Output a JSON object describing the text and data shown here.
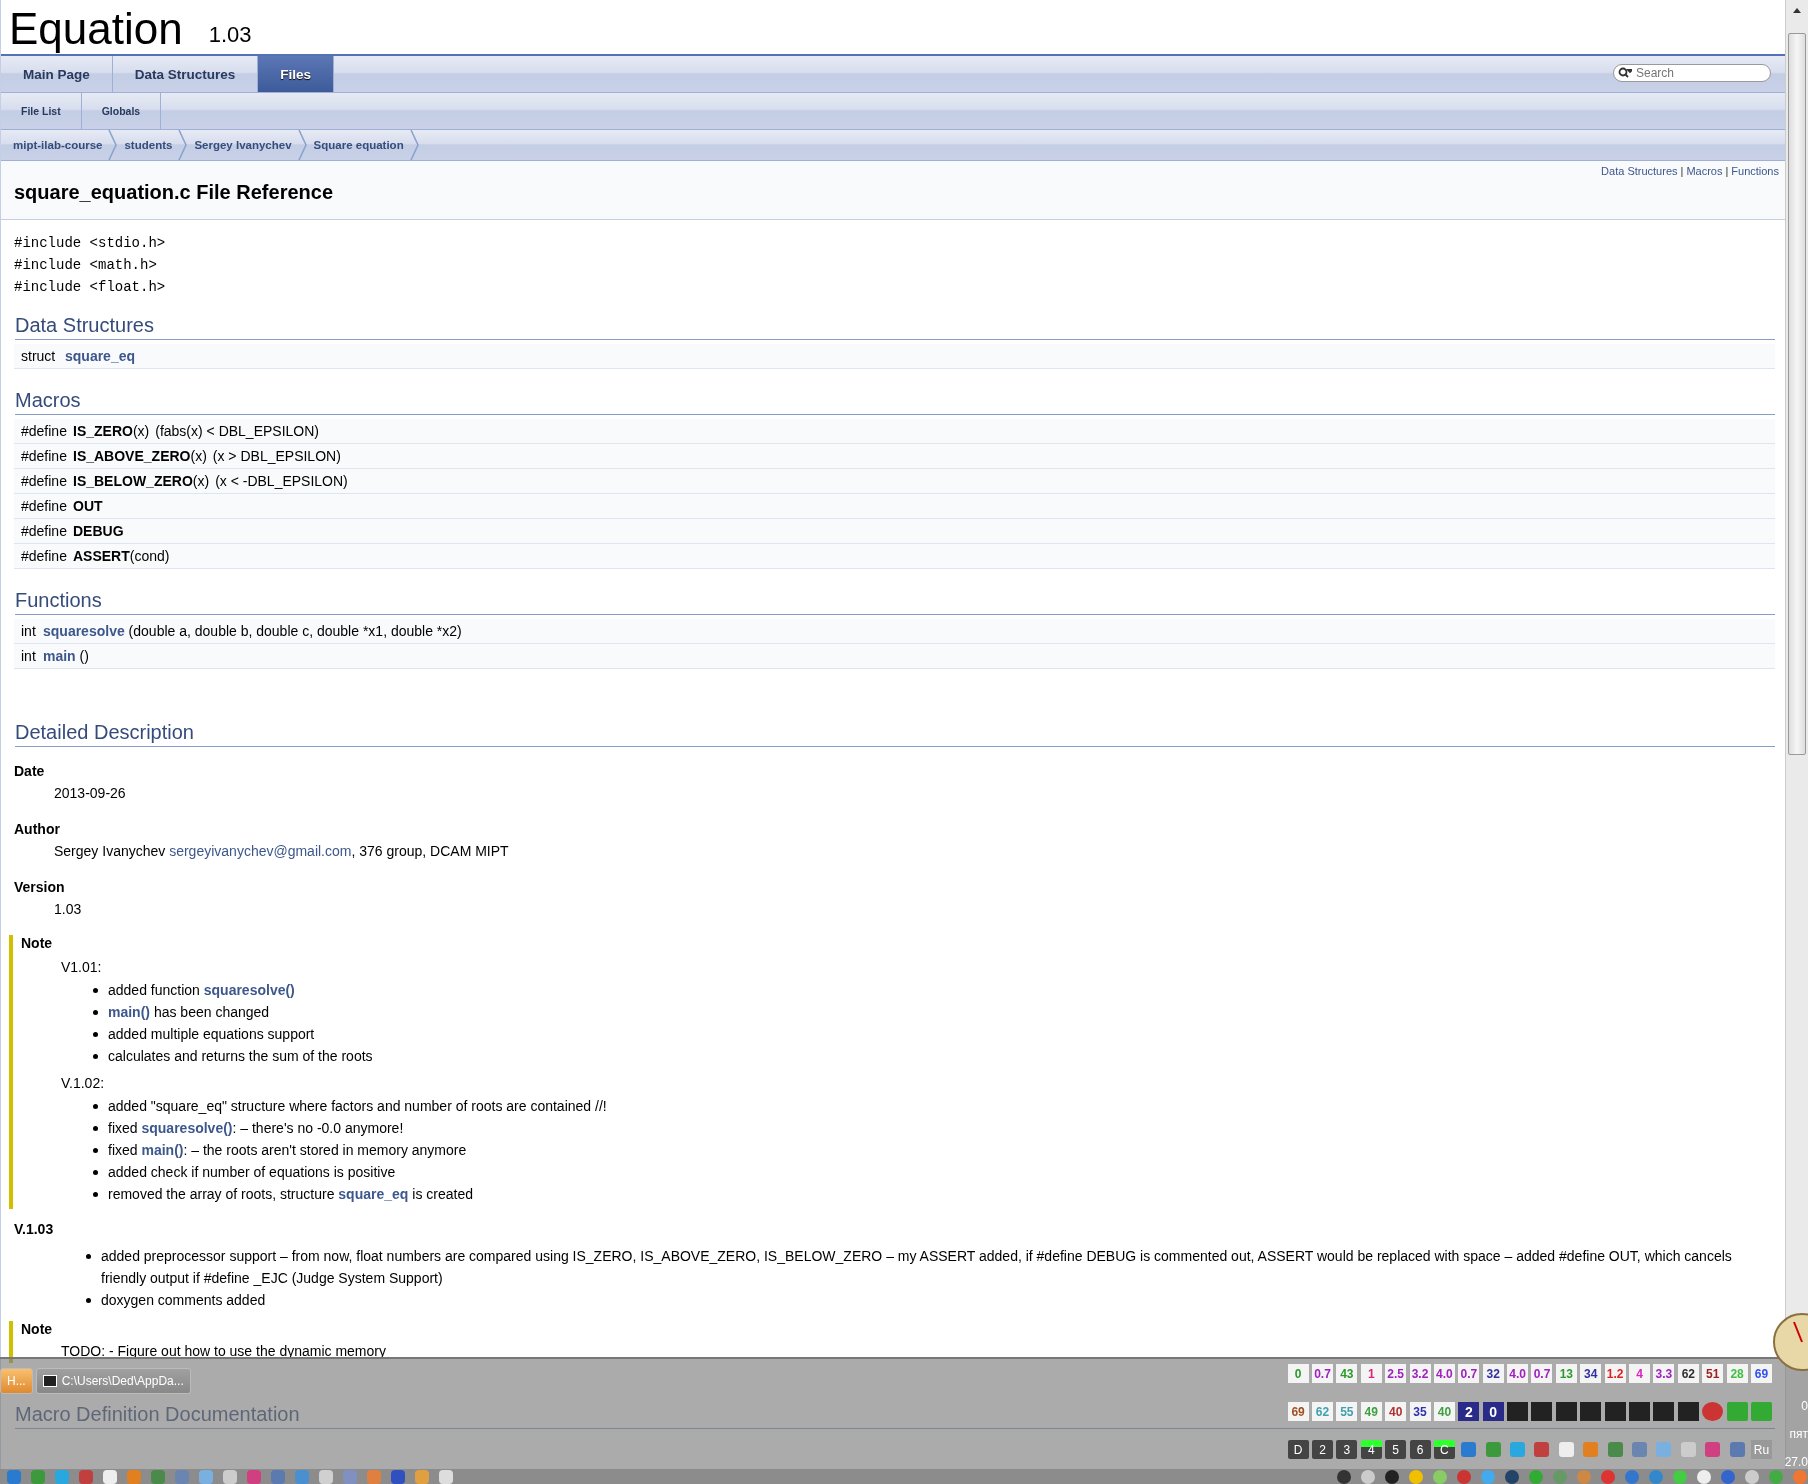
{
  "project": {
    "name": "Equation",
    "version": "1.03"
  },
  "main_tabs": [
    {
      "label": "Main Page",
      "selected": false
    },
    {
      "label": "Data Structures",
      "selected": false
    },
    {
      "label": "Files",
      "selected": true
    }
  ],
  "search": {
    "placeholder": "Search"
  },
  "sub_tabs": [
    {
      "label": "File List",
      "selected": false
    },
    {
      "label": "Globals",
      "selected": false
    }
  ],
  "breadcrumb": [
    "mipt-ilab-course",
    "students",
    "Sergey Ivanychev",
    "Square equation"
  ],
  "summary": {
    "links": [
      "Data Structures",
      "Macros",
      "Functions"
    ],
    "separator": "|"
  },
  "title": "square_equation.c File Reference",
  "includes": [
    "#include <stdio.h>",
    "#include <math.h>",
    "#include <float.h>"
  ],
  "sections": [
    {
      "heading": "Data Structures",
      "rows": [
        {
          "type": "struct",
          "name": "square_eq",
          "link": true
        }
      ]
    },
    {
      "heading": "Macros",
      "rows": [
        {
          "type": "#define",
          "name": "IS_ZERO",
          "link": false,
          "args": "(x)",
          "value": "(fabs(x) < DBL_EPSILON)"
        },
        {
          "type": "#define",
          "name": "IS_ABOVE_ZERO",
          "link": false,
          "args": "(x)",
          "value": "(x > DBL_EPSILON)"
        },
        {
          "type": "#define",
          "name": "IS_BELOW_ZERO",
          "link": false,
          "args": "(x)",
          "value": "(x < -DBL_EPSILON)"
        },
        {
          "type": "#define",
          "name": "OUT",
          "link": false
        },
        {
          "type": "#define",
          "name": "DEBUG",
          "link": false
        },
        {
          "type": "#define",
          "name": "ASSERT",
          "link": false,
          "args": "(cond)"
        }
      ]
    },
    {
      "heading": "Functions",
      "rows": [
        {
          "type": "int",
          "name": "squaresolve",
          "link": true,
          "args": "(double a, double b, double c, double *x1, double *x2)"
        },
        {
          "type": "int",
          "name": "main",
          "link": true,
          "args": "()"
        }
      ]
    }
  ],
  "detailed": {
    "heading": "Detailed Description",
    "fields": [
      {
        "label": "Date",
        "parts": [
          {
            "text": "2013-09-26",
            "link": false
          }
        ]
      },
      {
        "label": "Author",
        "parts": [
          {
            "text": "Sergey Ivanychev ",
            "link": false
          },
          {
            "text": "sergeyivanychev@gmail.com",
            "link": true
          },
          {
            "text": ", 376 group, DCAM MIPT",
            "link": false
          }
        ]
      },
      {
        "label": "Version",
        "parts": [
          {
            "text": "1.03",
            "link": false
          }
        ]
      }
    ],
    "note": {
      "label": "Note",
      "versions": [
        {
          "title": "V1.01:",
          "items": [
            [
              {
                "text": "added function ",
                "link": false
              },
              {
                "text": "squaresolve()",
                "link": true
              }
            ],
            [
              {
                "text": "main()",
                "link": true
              },
              {
                "text": " has been changed",
                "link": false
              }
            ],
            [
              {
                "text": "added multiple equations support",
                "link": false
              }
            ],
            [
              {
                "text": "calculates and returns the sum of the roots",
                "link": false
              }
            ]
          ]
        },
        {
          "title": "V.1.02:",
          "items": [
            [
              {
                "text": "added \"square_eq\" structure where factors and number of roots are contained //!",
                "link": false
              }
            ],
            [
              {
                "text": "fixed ",
                "link": false
              },
              {
                "text": "squaresolve()",
                "link": true
              },
              {
                "text": ": – there's no -0.0 anymore!",
                "link": false
              }
            ],
            [
              {
                "text": "fixed ",
                "link": false
              },
              {
                "text": "main()",
                "link": true
              },
              {
                "text": ": – the roots aren't stored in memory anymore",
                "link": false
              }
            ],
            [
              {
                "text": "added check if number of equations is positive",
                "link": false
              }
            ],
            [
              {
                "text": "removed the array of roots, structure ",
                "link": false
              },
              {
                "text": "square_eq",
                "link": true
              },
              {
                "text": " is created",
                "link": false
              }
            ]
          ]
        }
      ]
    },
    "changes": {
      "title": "V.1.03",
      "items": [
        "added preprocessor support – from now, float numbers are compared using IS_ZERO, IS_ABOVE_ZERO, IS_BELOW_ZERO – my ASSERT added, if #define DEBUG is commented out, ASSERT would be replaced with space – added #define OUT, which cancels friendly output if #define _EJC (Judge System Support)",
        "doxygen comments added"
      ]
    },
    "note2": {
      "label": "Note",
      "text": "TODO: - Figure out how to use the dynamic memory"
    }
  },
  "macro_doc_heading": "Macro Definition Documentation",
  "taskbar": {
    "windows": [
      {
        "label": "H...",
        "selected": true
      },
      {
        "label": "C:\\Users\\Ded\\AppDa...",
        "selected": false
      }
    ],
    "meters": [
      [
        {
          "value": "0",
          "color": "#2a9a2a",
          "kind": "light"
        },
        {
          "value": "0.7",
          "color": "#a020c0",
          "kind": "light"
        },
        {
          "value": "43",
          "color": "#2a9a2a",
          "kind": "light"
        },
        {
          "value": "1",
          "color": "#e0207a",
          "kind": "light"
        },
        {
          "value": "2.5",
          "color": "#a020c0",
          "kind": "light"
        },
        {
          "value": "3.2",
          "color": "#a020c0",
          "kind": "light"
        },
        {
          "value": "4.0",
          "color": "#a020c0",
          "kind": "light"
        },
        {
          "value": "0.7",
          "color": "#a020c0",
          "kind": "light"
        },
        {
          "value": "32",
          "color": "#3030a0",
          "kind": "light"
        },
        {
          "value": "4.0",
          "color": "#a020c0",
          "kind": "light"
        },
        {
          "value": "0.7",
          "color": "#a020c0",
          "kind": "light"
        },
        {
          "value": "13",
          "color": "#2a9a2a",
          "kind": "light"
        },
        {
          "value": "34",
          "color": "#3030a0",
          "kind": "light"
        },
        {
          "value": "1.2",
          "color": "#e02020",
          "kind": "light"
        },
        {
          "value": "4",
          "color": "#e020c0",
          "kind": "light"
        },
        {
          "value": "3.3",
          "color": "#a020c0",
          "kind": "light"
        },
        {
          "value": "62",
          "color": "#303030",
          "kind": "light"
        },
        {
          "value": "51",
          "color": "#a02020",
          "kind": "light"
        },
        {
          "value": "28",
          "color": "#40c040",
          "kind": "light"
        },
        {
          "value": "69",
          "color": "#3050f0",
          "kind": "light"
        }
      ],
      [
        {
          "value": "69",
          "color": "#a05020",
          "kind": "light"
        },
        {
          "value": "62",
          "color": "#40a0b0",
          "kind": "light"
        },
        {
          "value": "55",
          "color": "#40a0b0",
          "kind": "light"
        },
        {
          "value": "49",
          "color": "#40a040",
          "kind": "light"
        },
        {
          "value": "40",
          "color": "#b03030",
          "kind": "light"
        },
        {
          "value": "35",
          "color": "#3030b0",
          "kind": "light"
        },
        {
          "value": "40",
          "color": "#40a040",
          "kind": "light"
        },
        {
          "value": "2",
          "kind": "dark"
        },
        {
          "value": "0",
          "kind": "dark"
        }
      ]
    ],
    "desktops": [
      {
        "label": "D",
        "active": false
      },
      {
        "label": "2",
        "active": false
      },
      {
        "label": "3",
        "active": false
      },
      {
        "label": "4",
        "active": true
      },
      {
        "label": "5",
        "active": false
      },
      {
        "label": "6",
        "active": false
      },
      {
        "label": "C",
        "active": true
      }
    ],
    "language": "Ru",
    "clock": [
      "0",
      "пят",
      "27.0"
    ]
  }
}
